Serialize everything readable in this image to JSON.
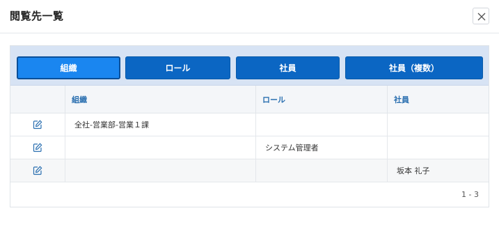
{
  "dialog": {
    "title": "閲覧先一覧",
    "close_icon": "close-icon"
  },
  "tabs": [
    {
      "label": "組織",
      "active": true
    },
    {
      "label": "ロール",
      "active": false
    },
    {
      "label": "社員",
      "active": false
    },
    {
      "label": "社員（複数）",
      "active": false
    }
  ],
  "table": {
    "columns": [
      "",
      "組織",
      "ロール",
      "社員"
    ],
    "rows": [
      {
        "edit_icon": "edit-icon",
        "organization": "全社-営業部-営業１課",
        "role": "",
        "employee": ""
      },
      {
        "edit_icon": "edit-icon",
        "organization": "",
        "role": "システム管理者",
        "employee": ""
      },
      {
        "edit_icon": "edit-icon",
        "organization": "",
        "role": "",
        "employee": "坂本 礼子"
      }
    ]
  },
  "pager": {
    "range": "1 - 3"
  },
  "colors": {
    "tab_bg": "#0b66c3",
    "tab_active_bg": "#1a86f0",
    "tab_bar_bg": "#d7e3f4",
    "header_text": "#2a6fb0",
    "icon": "#2a6fb0"
  }
}
